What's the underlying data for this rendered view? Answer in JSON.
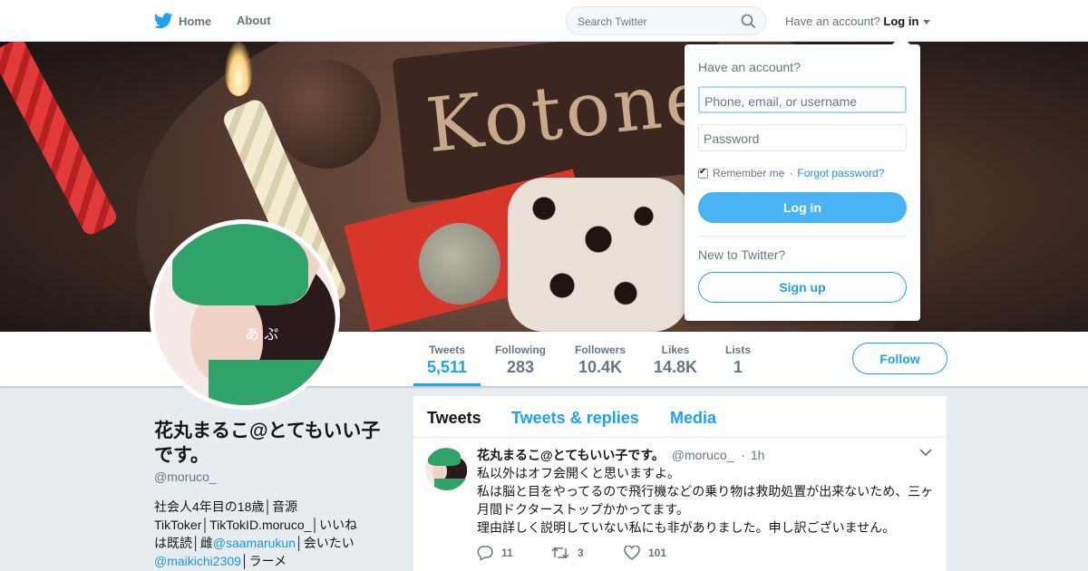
{
  "nav": {
    "home_label": "Home",
    "about_label": "About",
    "search_placeholder": "Search Twitter",
    "have_account_text": "Have an account?",
    "login_link": "Log in"
  },
  "login_dropdown": {
    "title": "Have an account?",
    "username_placeholder": "Phone, email, or username",
    "password_placeholder": "Password",
    "remember_me": "Remember me",
    "separator": "·",
    "forgot_password": "Forgot password?",
    "login_button": "Log in",
    "new_to_twitter": "New to Twitter?",
    "signup_button": "Sign up",
    "remember_checked": true
  },
  "banner": {
    "sign_text": "Kotone"
  },
  "profile": {
    "name": "花丸まるこ@とてもいい子です。",
    "handle": "@moruco_",
    "bio": {
      "part1": "社会人4年目の18歳│音源TikToker│TikTokID.moruco_│いいねは既読│雌",
      "mention1": "@saamarukun",
      "part2": "│会いたい",
      "mention2": "@maikichi2309",
      "part3": "│ラーメ"
    },
    "avatar_signature": "あ ぷ"
  },
  "stats": [
    {
      "label": "Tweets",
      "value": "5,511",
      "active": true
    },
    {
      "label": "Following",
      "value": "283"
    },
    {
      "label": "Followers",
      "value": "10.4K"
    },
    {
      "label": "Likes",
      "value": "14.8K"
    },
    {
      "label": "Lists",
      "value": "1"
    }
  ],
  "follow_button": "Follow",
  "timeline": {
    "tabs": [
      {
        "label": "Tweets",
        "active": true
      },
      {
        "label": "Tweets & replies"
      },
      {
        "label": "Media"
      }
    ],
    "tweet": {
      "author_name": "花丸まるこ@とてもいい子です。",
      "author_handle": "@moruco_",
      "separator": "·",
      "time": "1h",
      "lines": [
        "私以外はオフ会開くと思いますよ。",
        "私は脳と目をやってるので飛行機などの乗り物は救助処置が出来ないため、三ヶ月間ドクターストップかかってます。",
        "理由詳しく説明していない私にも非がありました。申し訳ございません。"
      ],
      "replies": "11",
      "retweets": "3",
      "likes": "101"
    }
  },
  "colors": {
    "accent": "#1da1f2",
    "background": "#e6ecf0",
    "text_secondary": "#657786"
  },
  "icons": [
    "twitter-bird-icon",
    "home-icon",
    "search-icon",
    "caret-down-icon",
    "chevron-down-icon",
    "reply-icon",
    "retweet-icon",
    "like-icon"
  ]
}
